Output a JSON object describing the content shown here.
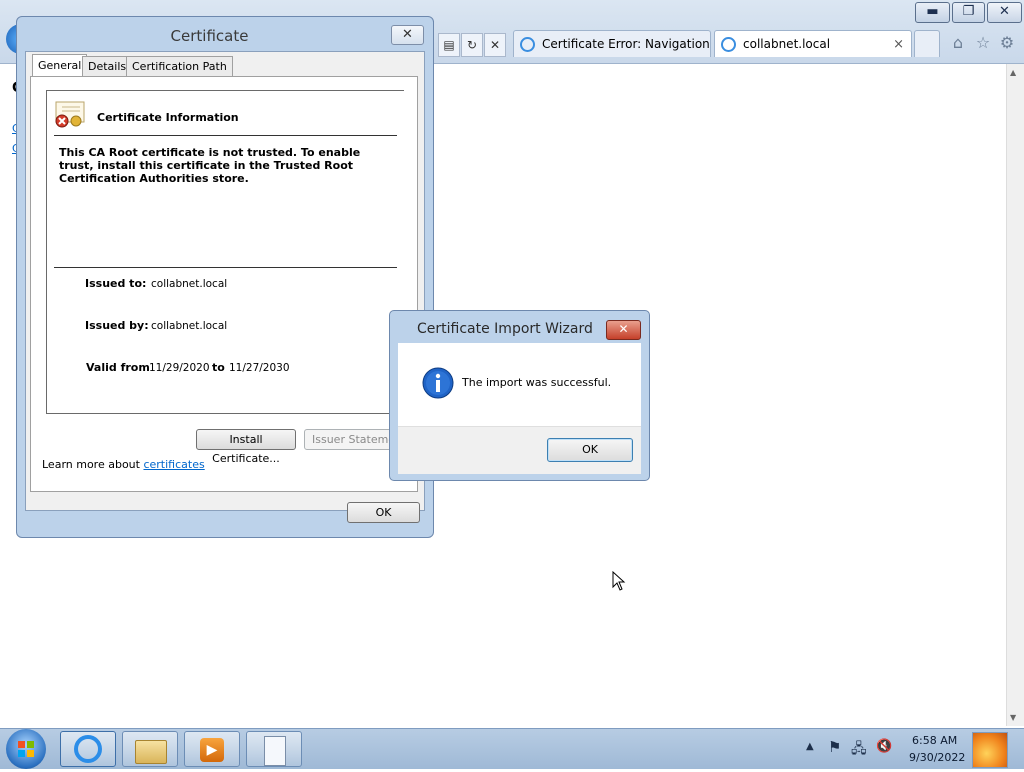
{
  "browser": {
    "tabs": [
      {
        "label": "Certificate Error: Navigation B..."
      },
      {
        "label": "collabnet.local"
      }
    ],
    "tab_close": "×"
  },
  "page_fragments": {
    "heading": "C",
    "link1": "C",
    "link2": "C"
  },
  "certificate_dialog": {
    "title": "Certificate",
    "tabs": [
      "General",
      "Details",
      "Certification Path"
    ],
    "info_heading": "Certificate Information",
    "warning_text": "This CA Root certificate is not trusted. To enable trust, install this certificate in the Trusted Root Certification Authorities store.",
    "issued_to_label": "Issued to:",
    "issued_to_value": "collabnet.local",
    "issued_by_label": "Issued by:",
    "issued_by_value": "collabnet.local",
    "valid_from_label": "Valid from",
    "valid_from_value": "11/29/2020",
    "valid_to_label": "to",
    "valid_to_value": "11/27/2030",
    "install_button": "Install Certificate...",
    "issuer_button": "Issuer Statement",
    "learn_more_text": "Learn more about",
    "learn_more_link": "certificates",
    "ok_button": "OK"
  },
  "wizard": {
    "title": "Certificate Import Wizard",
    "message": "The import was successful.",
    "ok_button": "OK"
  },
  "taskbar": {
    "time": "6:58 AM",
    "date": "9/30/2022"
  },
  "colors": {
    "accent": "#1f63c6",
    "link": "#0066cc"
  }
}
